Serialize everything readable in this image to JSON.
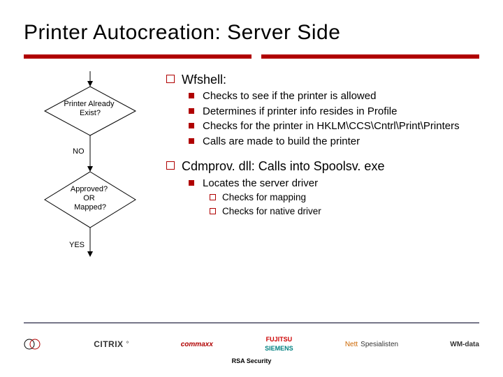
{
  "title": "Printer Autocreation: Server Side",
  "flowchart": {
    "box1": "Printer Already\nExist?",
    "box1_out": "NO",
    "box2": "Approved?\nOR\nMapped?",
    "box2_out": "YES"
  },
  "bullets": {
    "b1": {
      "label": "Wfshell:",
      "items": [
        "Checks to see if the printer is allowed",
        "Determines if printer info resides in Profile",
        "Checks for the printer in HKLM\\CCS\\Cntrl\\Print\\Printers",
        "Calls are made to build the printer"
      ]
    },
    "b2": {
      "label": "Cdmprov. dll: Calls into Spoolsv. exe",
      "items": [
        {
          "label": "Locates the server driver",
          "sub": [
            "Checks for mapping",
            "Checks for native driver"
          ]
        }
      ]
    }
  },
  "footer": {
    "logos": [
      "CUG",
      "CITRIX",
      "commaxx",
      "FUJITSU SIEMENS",
      "NettSpesialisten",
      "WM-data"
    ],
    "bottom": "RSA Security"
  }
}
